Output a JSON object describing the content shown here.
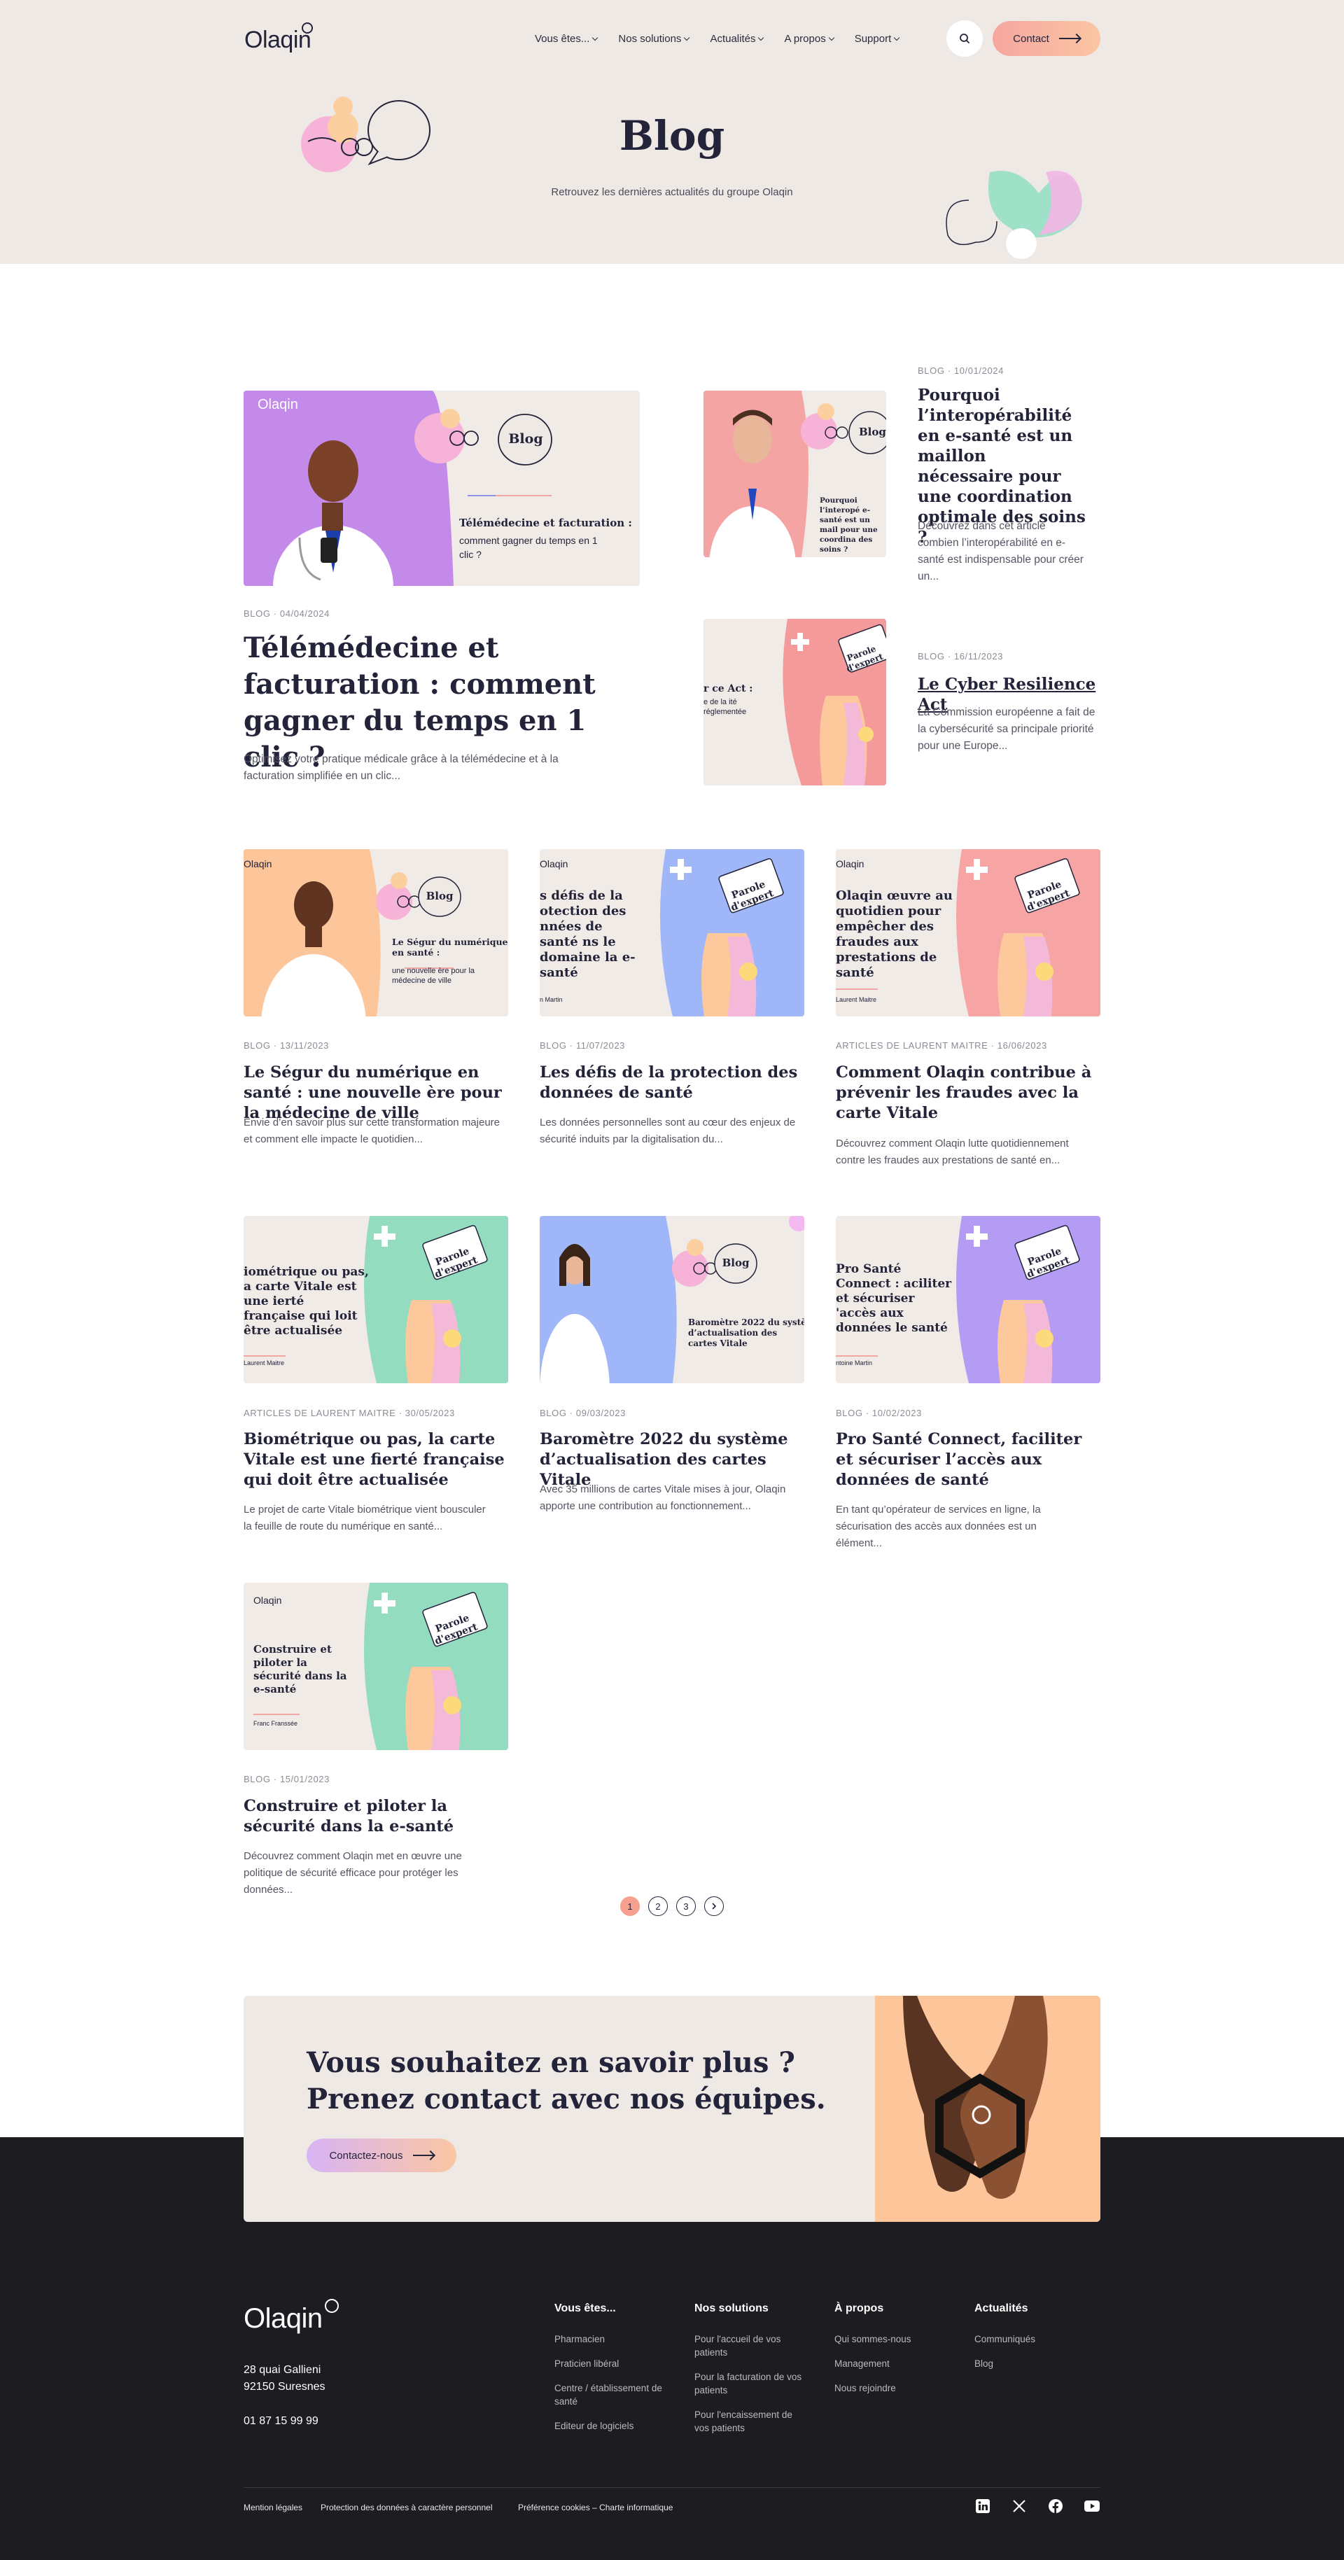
{
  "header": {
    "logo": "Olaqin",
    "nav": [
      {
        "label": "Vous êtes..."
      },
      {
        "label": "Nos solutions"
      },
      {
        "label": "Actualités"
      },
      {
        "label": "A propos"
      },
      {
        "label": "Support"
      }
    ],
    "contact_label": "Contact"
  },
  "hero": {
    "title": "Blog",
    "subtitle": "Retrouvez les dernières actualités du groupe Olaqin"
  },
  "featured": {
    "meta": "BLOG · 04/04/2024",
    "title": "Télémédecine et facturation : comment gagner du temps en 1 clic ?",
    "excerpt": "Optimisez votre pratique médicale grâce à la télémédecine et à la facturation simplifiée en un clic...",
    "thumb": {
      "logo": "Olaqin",
      "bubble": "Blog",
      "title": "Télémédecine et facturation :",
      "subtitle": "comment gagner du temps en 1 clic ?"
    }
  },
  "side": [
    {
      "meta": "BLOG · 10/01/2024",
      "title": "Pourquoi l’interopérabilité en e-santé est un maillon nécessaire pour une coordination optimale des soins ?",
      "excerpt": "Découvrez dans cet article combien l’interopérabilité en e-santé est indispensable pour créer un...",
      "thumb": {
        "bubble": "Blog",
        "title": "Pourquoi l’interopé e-santé est un mail pour une coordina des soins ?"
      }
    },
    {
      "meta": "BLOG · 16/11/2023",
      "title": "Le Cyber Resilience Act",
      "excerpt": "La Commission européenne a fait de la cybersécurité sa principale priorité pour une Europe...",
      "thumb": {
        "bubble": "Parole d'expert",
        "title": "r ce Act :",
        "subtitle": "e de la ité réglementée"
      }
    }
  ],
  "cards": [
    {
      "meta": "BLOG · 13/11/2023",
      "title": "Le Ségur du numérique en santé : une nouvelle ère pour la médecine de ville",
      "excerpt": "Envie d’en savoir plus sur cette transformation majeure et comment elle impacte le quotidien...",
      "thumb": {
        "logo": "Olaqin",
        "bubble": "Blog",
        "title": "Le Ségur du numérique en santé :",
        "subtitle": "une nouvelle ère pour la médecine de ville"
      }
    },
    {
      "meta": "BLOG · 11/07/2023",
      "title": "Les défis de la protection des données de santé",
      "excerpt": "Les données personnelles sont au cœur des enjeux de sécurité induits par la digitalisation du...",
      "thumb": {
        "logo": "Olaqin",
        "bubble": "Parole d'expert",
        "title": "s défis de la otection des nnées de santé ns le domaine la e-santé",
        "subtitle": "n Martin"
      }
    },
    {
      "meta": "ARTICLES DE LAURENT MAITRE · 16/06/2023",
      "title": "Comment Olaqin contribue à prévenir les fraudes avec la carte Vitale",
      "excerpt": "Découvrez comment Olaqin lutte quotidiennement contre les fraudes aux prestations de santé en...",
      "thumb": {
        "logo": "Olaqin",
        "bubble": "Parole d'expert",
        "title": "Olaqin œuvre au quotidien pour empêcher des fraudes aux prestations de santé",
        "subtitle": "Laurent Maitre"
      }
    },
    {
      "meta": "ARTICLES DE LAURENT MAITRE · 30/05/2023",
      "title": "Biométrique ou pas, la carte Vitale est une fierté française qui doit être actualisée",
      "excerpt": "Le projet de carte Vitale biométrique vient bousculer la feuille de route du numérique en santé...",
      "thumb": {
        "logo": "",
        "bubble": "Parole d'expert",
        "title": "iométrique ou pas, a carte Vitale est une ierté française qui loit être actualisée",
        "subtitle": "Laurent Maitre"
      }
    },
    {
      "meta": "BLOG · 09/03/2023",
      "title": "Baromètre 2022 du système d’actualisation des cartes Vitale",
      "excerpt": "Avec 35 millions de cartes Vitale mises à jour, Olaqin apporte une contribution au fonctionnement...",
      "thumb": {
        "logo": "",
        "bubble": "Blog",
        "title": "Baromètre 2022 du systè d’actualisation des cartes Vitale",
        "subtitle": ""
      }
    },
    {
      "meta": "BLOG · 10/02/2023",
      "title": "Pro Santé Connect, faciliter et sécuriser l’accès aux données de santé",
      "excerpt": "En tant qu’opérateur de services en ligne, la sécurisation des accès aux données est un élément...",
      "thumb": {
        "logo": "",
        "bubble": "Parole d'expert",
        "title": "Pro Santé Connect : aciliter et sécuriser 'accès aux données le santé",
        "subtitle": "ntoine Martin"
      }
    },
    {
      "meta": "BLOG · 15/01/2023",
      "title": "Construire et piloter la sécurité dans la e-santé",
      "excerpt": "Découvrez comment Olaqin met en œuvre une politique de sécurité efficace pour protéger les données...",
      "thumb": {
        "logo": "Olaqin",
        "bubble": "Parole d'expert",
        "title": "Construire et piloter la sécurité dans la e-santé",
        "subtitle": "Franc Franssée"
      }
    }
  ],
  "pagination": {
    "pages": [
      "1",
      "2",
      "3"
    ],
    "active": "1"
  },
  "cta": {
    "line1": "Vous souhaitez en savoir plus ?",
    "line2": "Prenez contact avec nos équipes.",
    "button": "Contactez-nous"
  },
  "footer": {
    "logo": "Olaqin",
    "address1": "28 quai Gallieni",
    "address2": "92150 Suresnes",
    "phone": "01 87 15 99 99",
    "columns": [
      {
        "title": "Vous êtes...",
        "links": [
          "Pharmacien",
          "Praticien libéral",
          "Centre / établissement de santé",
          "Editeur de logiciels"
        ]
      },
      {
        "title": "Nos solutions",
        "links": [
          "Pour l'accueil de vos patients",
          "Pour la facturation de vos patients",
          "Pour l'encaissement de vos patients"
        ]
      },
      {
        "title": "À propos",
        "links": [
          "Qui sommes-nous",
          "Management",
          "Nous rejoindre"
        ]
      },
      {
        "title": "Actualités",
        "links": [
          "Communiqués",
          "Blog"
        ]
      }
    ],
    "legal": [
      "Mention légales",
      "Protection des données à caractère personnel",
      "Préférence cookies – Charte informatique"
    ],
    "social": [
      "linkedin-icon",
      "x-icon",
      "facebook-icon",
      "youtube-icon"
    ]
  }
}
